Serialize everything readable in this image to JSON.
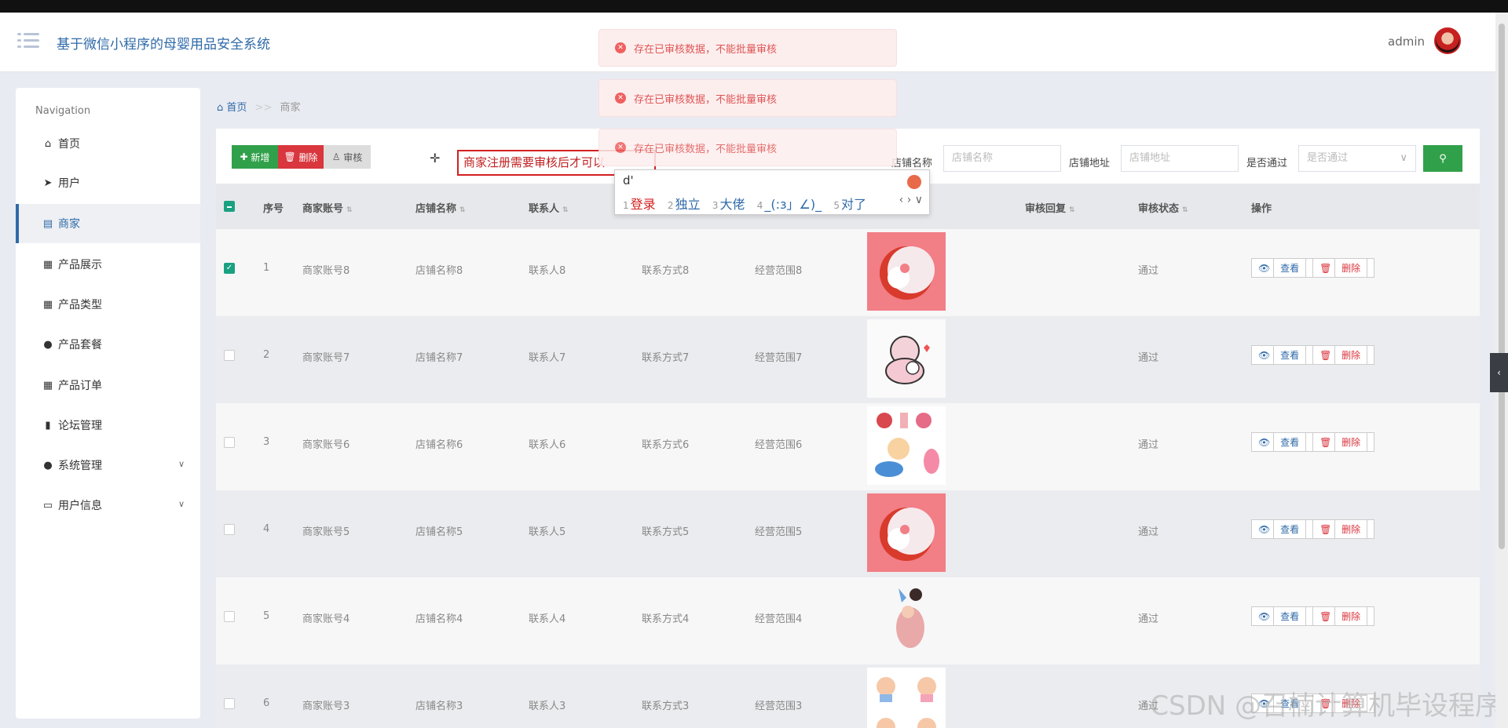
{
  "header": {
    "app_title": "基于微信小程序的母婴用品安全系统",
    "user": "admin"
  },
  "sidebar": {
    "title": "Navigation",
    "items": [
      {
        "label": "首页",
        "icon": "home-icon"
      },
      {
        "label": "用户",
        "icon": "paper-plane-icon"
      },
      {
        "label": "商家",
        "icon": "briefcase-icon"
      },
      {
        "label": "产品展示",
        "icon": "grid-icon"
      },
      {
        "label": "产品类型",
        "icon": "grid-icon"
      },
      {
        "label": "产品套餐",
        "icon": "user-icon"
      },
      {
        "label": "产品订单",
        "icon": "grid-icon"
      },
      {
        "label": "论坛管理",
        "icon": "bar-chart-icon"
      },
      {
        "label": "系统管理",
        "icon": "user-icon"
      },
      {
        "label": "用户信息",
        "icon": "card-icon"
      }
    ]
  },
  "breadcrumb": {
    "home": "首页",
    "separator": ">>",
    "current": "商家"
  },
  "toolbar": {
    "add": "新增",
    "delete": "删除",
    "audit": "审核",
    "annotation": "商家注册需要审核后才可以",
    "filters": [
      {
        "label": "店铺名称",
        "placeholder": "店铺名称"
      },
      {
        "label": "店铺地址",
        "placeholder": "店铺地址"
      },
      {
        "label": "是否通过",
        "placeholder": "是否通过"
      }
    ]
  },
  "table": {
    "headers": [
      "序号",
      "商家账号",
      "店铺名称",
      "联系人",
      "审核回复",
      "审核状态",
      "操作"
    ],
    "rows": [
      {
        "no": "1",
        "account": "商家账号8",
        "shop": "店铺名称8",
        "contact": "联系人8",
        "phone": "联系方式8",
        "scope": "经营范围8",
        "status": "通过",
        "checked": true
      },
      {
        "no": "2",
        "account": "商家账号7",
        "shop": "店铺名称7",
        "contact": "联系人7",
        "phone": "联系方式7",
        "scope": "经营范围7",
        "status": "通过",
        "checked": false
      },
      {
        "no": "3",
        "account": "商家账号6",
        "shop": "店铺名称6",
        "contact": "联系人6",
        "phone": "联系方式6",
        "scope": "经营范围6",
        "status": "通过",
        "checked": false
      },
      {
        "no": "4",
        "account": "商家账号5",
        "shop": "店铺名称5",
        "contact": "联系人5",
        "phone": "联系方式5",
        "scope": "经营范围5",
        "status": "通过",
        "checked": false
      },
      {
        "no": "5",
        "account": "商家账号4",
        "shop": "店铺名称4",
        "contact": "联系人4",
        "phone": "联系方式4",
        "scope": "经营范围4",
        "status": "通过",
        "checked": false
      },
      {
        "no": "6",
        "account": "商家账号3",
        "shop": "店铺名称3",
        "contact": "联系人3",
        "phone": "联系方式3",
        "scope": "经营范围3",
        "status": "通过",
        "checked": false
      }
    ],
    "view_label": "查看",
    "delete_label": "删除"
  },
  "toasts": [
    "存在已审核数据，不能批量审核",
    "存在已审核数据，不能批量审核",
    "存在已审核数据，不能批量审核"
  ],
  "ime": {
    "input": "d'",
    "candidates": [
      {
        "n": "1",
        "text": "登录"
      },
      {
        "n": "2",
        "text": "独立"
      },
      {
        "n": "3",
        "text": "大佬"
      },
      {
        "n": "4",
        "text": "_(:з」∠)_"
      },
      {
        "n": "5",
        "text": "对了"
      }
    ]
  },
  "watermark": "CSDN @召楠计算机毕设程序",
  "colors": {
    "accent": "#2f6aa8",
    "green": "#31a04a",
    "red": "#d9363e",
    "toast_bg": "#fdeeee"
  }
}
